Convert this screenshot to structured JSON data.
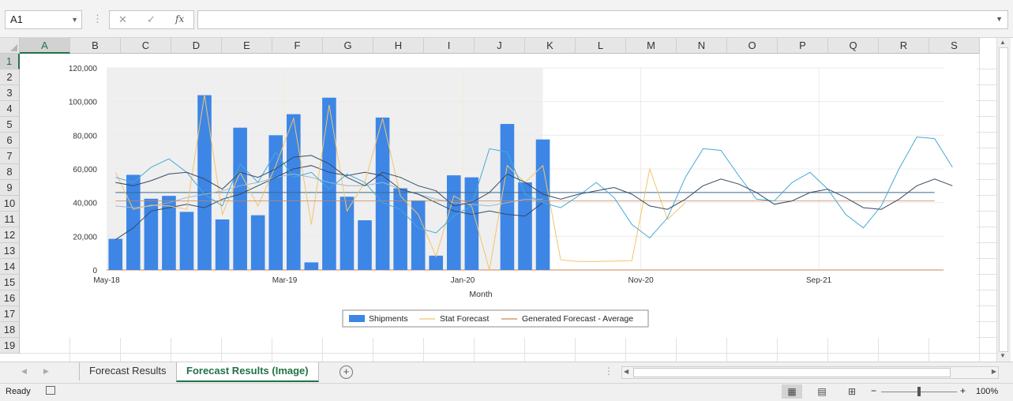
{
  "formula_bar": {
    "name_box": "A1",
    "fx_label": "fx",
    "formula_value": ""
  },
  "columns": [
    "A",
    "B",
    "C",
    "D",
    "E",
    "F",
    "G",
    "H",
    "I",
    "J",
    "K",
    "L",
    "M",
    "N",
    "O",
    "P",
    "Q",
    "R",
    "S"
  ],
  "rows": [
    "1",
    "2",
    "3",
    "4",
    "5",
    "6",
    "7",
    "8",
    "9",
    "10",
    "11",
    "12",
    "13",
    "14",
    "15",
    "16",
    "17",
    "18",
    "19"
  ],
  "selected_cell": {
    "column": "A",
    "row": "1"
  },
  "sheet_tabs": [
    {
      "label": "Forecast Results",
      "active": false
    },
    {
      "label": "Forecast Results (Image)",
      "active": true
    }
  ],
  "status_bar": {
    "ready": "Ready",
    "zoom": "100%"
  },
  "chart_data": {
    "type": "bar",
    "xlabel": "Month",
    "x_tick_labels": [
      "May-18",
      "Mar-19",
      "Jan-20",
      "Nov-20",
      "Sep-21"
    ],
    "y_tick_labels": [
      "0",
      "20,000",
      "40,000",
      "60,000",
      "80,000",
      "100,000",
      "120,000"
    ],
    "ylim": [
      0,
      120000
    ],
    "grid": true,
    "legend_position": "bottom",
    "history_months": 25,
    "total_months": 47,
    "legend": [
      "Shipments",
      "Stat Forecast",
      "Generated Forecast - Average"
    ],
    "colors": {
      "Shipments": "#3d86e6",
      "Stat Forecast": "#f2c56b",
      "Generated Forecast - Average": "#c9865a",
      "forecast_a": "#45a9d6",
      "forecast_b": "#354a66",
      "forecast_c": "#9fb6cc",
      "history_shading": "#efefef"
    },
    "series": [
      {
        "name": "Shipments",
        "values": [
          18500,
          56500,
          42300,
          44000,
          34500,
          103800,
          30000,
          84500,
          32500,
          80000,
          92500,
          4500,
          102300,
          43500,
          29500,
          90500,
          48500,
          41300,
          8500,
          56200,
          55000,
          0,
          86700,
          52000,
          77500
        ]
      },
      {
        "name": "Stat Forecast",
        "values": [
          58000,
          36000,
          38500,
          38000,
          36000,
          104000,
          33000,
          58000,
          38000,
          62000,
          90000,
          27000,
          98000,
          35000,
          52000,
          90000,
          44000,
          33000,
          8000,
          44000,
          38000,
          0,
          62000,
          52000,
          62000,
          6000,
          5000,
          5000,
          5300,
          5500,
          60000,
          30000,
          40000
        ]
      },
      {
        "name": "Generated Forecast - Average",
        "values": [
          41000,
          41000,
          41000,
          41000,
          41000,
          41000,
          41000,
          41000,
          41000,
          41000,
          41000,
          41000,
          41000,
          41000,
          41000,
          41000,
          41000,
          41000,
          41000,
          41000,
          41000,
          41000,
          41000,
          41000,
          41000,
          41000,
          41000,
          41000,
          41000,
          41000,
          41000,
          41000,
          41000,
          41000,
          41000,
          41000,
          41000,
          41000,
          41000,
          41000,
          41000,
          41000,
          41000,
          41000,
          41000,
          41000,
          41000
        ]
      },
      {
        "values": [
          55000,
          52000,
          61000,
          66000,
          58000,
          45000,
          38000,
          63000,
          52000,
          70000,
          55000,
          58000,
          48000,
          57000,
          52000,
          40000,
          36000,
          25000,
          22000,
          32000,
          38000,
          72000,
          70000,
          45000,
          40000,
          37000,
          44000,
          52000,
          43000,
          27000,
          19000,
          31000,
          55000,
          72000,
          71000,
          56000,
          42000,
          41000,
          52000,
          58000,
          48000,
          33000,
          25000,
          38000,
          60000,
          79000,
          78000,
          61000
        ]
      },
      {
        "values": [
          52000,
          50000,
          53000,
          57000,
          58000,
          54000,
          48000,
          58000,
          55000,
          60000,
          67000,
          68000,
          63000,
          55000,
          50000,
          58000,
          55000,
          50000,
          47000,
          38000,
          40000,
          46000,
          57000,
          52000,
          45000,
          42000,
          45000,
          47000,
          49000,
          45000,
          38000,
          36000,
          42000,
          50000,
          54000,
          51000,
          46000,
          39000,
          41000,
          46000,
          48000,
          43000,
          37000,
          36000,
          42000,
          50000,
          54000,
          50000
        ]
      },
      {
        "values": [
          18000,
          25000,
          35000,
          37000,
          39000,
          37000,
          42000,
          45000,
          50000,
          55000,
          60000,
          62000,
          58000,
          56000,
          58000,
          56000,
          48000,
          45000,
          40000,
          35000,
          33000,
          35000,
          33000,
          32000,
          40000
        ]
      },
      {
        "values": [
          46000,
          46000,
          46000,
          46000,
          46000,
          46000,
          46000,
          46000,
          46000,
          46000,
          46000,
          46000,
          46000,
          46000,
          46000,
          46000,
          46000,
          46000,
          46000,
          46000,
          46000,
          46000,
          46000,
          46000,
          46000,
          46000,
          46000,
          46000,
          46000,
          46000,
          46000,
          46000,
          46000,
          46000,
          46000,
          46000,
          46000,
          46000,
          46000,
          46000,
          46000,
          46000,
          46000,
          46000,
          46000,
          46000,
          46000
        ]
      },
      {
        "values": [
          38000,
          37000,
          38000,
          40000,
          43000,
          45000,
          47000,
          50000,
          52000,
          55000,
          57000,
          55000,
          52000,
          50000,
          50000,
          52000,
          48000,
          45000,
          42000,
          40000,
          39000,
          38000,
          40000,
          42000,
          42000
        ]
      }
    ]
  }
}
